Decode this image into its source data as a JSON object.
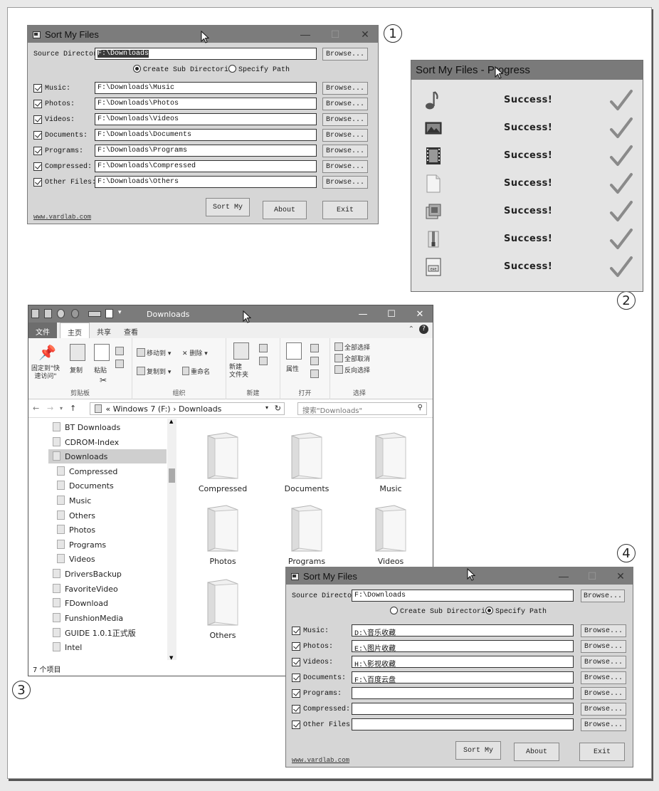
{
  "callouts": [
    "1",
    "2",
    "3",
    "4"
  ],
  "window1": {
    "title": "Sort My Files",
    "source_label": "Source Directory",
    "source_value": "F:\\Downloads",
    "radio_create": "Create Sub Directori",
    "radio_specify": "Specify Path",
    "rows": [
      {
        "label": "Music:",
        "value": "F:\\Downloads\\Music"
      },
      {
        "label": "Photos:",
        "value": "F:\\Downloads\\Photos"
      },
      {
        "label": "Videos:",
        "value": "F:\\Downloads\\Videos"
      },
      {
        "label": "Documents:",
        "value": "F:\\Downloads\\Documents"
      },
      {
        "label": "Programs:",
        "value": "F:\\Downloads\\Programs"
      },
      {
        "label": "Compressed:",
        "value": "F:\\Downloads\\Compressed"
      },
      {
        "label": "Other Files:",
        "value": "F:\\Downloads\\Others"
      }
    ],
    "browse": "Browse...",
    "sort_btn": "Sort My",
    "about_btn": "About",
    "exit_btn": "Exit",
    "link": "www.vardlab.com",
    "selected_radio": "Create Sub Directori"
  },
  "progress": {
    "title": "Sort My Files - Progress",
    "items": [
      {
        "icon": "music-note-icon",
        "status": "Success!"
      },
      {
        "icon": "photo-icon",
        "status": "Success!"
      },
      {
        "icon": "film-icon",
        "status": "Success!"
      },
      {
        "icon": "document-icon",
        "status": "Success!"
      },
      {
        "icon": "programs-icon",
        "status": "Success!"
      },
      {
        "icon": "archive-icon",
        "status": "Success!"
      },
      {
        "icon": "exe-file-icon",
        "status": "Success!"
      }
    ]
  },
  "explorer": {
    "title": "Downloads",
    "tabs": [
      "文件",
      "主页",
      "共享",
      "查看"
    ],
    "ribbon": {
      "pin": "固定到\"快速访问\"",
      "copy": "复制",
      "paste": "粘贴",
      "move_to": "移动到",
      "copy_to": "复制到",
      "delete": "删除",
      "rename": "重命名",
      "new_folder": "新建\n文件夹",
      "properties": "属性",
      "select_all": "全部选择",
      "select_none": "全部取消",
      "invert": "反向选择",
      "groups": [
        "剪贴板",
        "组织",
        "新建",
        "打开",
        "选择"
      ]
    },
    "address": {
      "path_prefix": "«",
      "drive": "Windows 7 (F:)",
      "sep": "›",
      "folder": "Downloads",
      "search_placeholder": "搜索\"Downloads\""
    },
    "tree": [
      {
        "label": "BT Downloads",
        "indent": 0
      },
      {
        "label": "CDROM-Index",
        "indent": 0
      },
      {
        "label": "Downloads",
        "indent": 0,
        "selected": true
      },
      {
        "label": "Compressed",
        "indent": 1
      },
      {
        "label": "Documents",
        "indent": 1
      },
      {
        "label": "Music",
        "indent": 1
      },
      {
        "label": "Others",
        "indent": 1
      },
      {
        "label": "Photos",
        "indent": 1
      },
      {
        "label": "Programs",
        "indent": 1
      },
      {
        "label": "Videos",
        "indent": 1
      },
      {
        "label": "DriversBackup",
        "indent": 0
      },
      {
        "label": "FavoriteVideo",
        "indent": 0
      },
      {
        "label": "FDownload",
        "indent": 0
      },
      {
        "label": "FunshionMedia",
        "indent": 0
      },
      {
        "label": "GUIDE 1.0.1正式版",
        "indent": 0
      },
      {
        "label": "Intel",
        "indent": 0
      }
    ],
    "folders": [
      "Compressed",
      "Documents",
      "Music",
      "Photos",
      "Programs",
      "Videos",
      "Others"
    ],
    "status": "7 个项目"
  },
  "window4": {
    "title": "Sort My Files",
    "source_label": "Source Directory",
    "source_value": "F:\\Downloads",
    "radio_create": "Create Sub Directori",
    "radio_specify": "Specify Path",
    "rows": [
      {
        "label": "Music:",
        "value": "D:\\音乐收藏"
      },
      {
        "label": "Photos:",
        "value": "E:\\图片收藏"
      },
      {
        "label": "Videos:",
        "value": "H:\\影视收藏"
      },
      {
        "label": "Documents:",
        "value": "F:\\百度云盘"
      },
      {
        "label": "Programs:",
        "value": ""
      },
      {
        "label": "Compressed:",
        "value": ""
      },
      {
        "label": "Other Files:",
        "value": ""
      }
    ],
    "browse": "Browse...",
    "sort_btn": "Sort My",
    "about_btn": "About",
    "exit_btn": "Exit",
    "link": "www.vardlab.com",
    "selected_radio": "Specify Path"
  }
}
